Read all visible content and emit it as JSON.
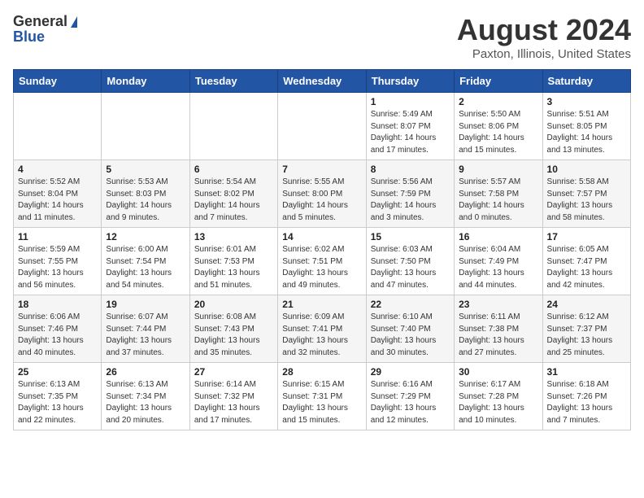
{
  "header": {
    "logo_general": "General",
    "logo_blue": "Blue",
    "title": "August 2024",
    "subtitle": "Paxton, Illinois, United States"
  },
  "days_of_week": [
    "Sunday",
    "Monday",
    "Tuesday",
    "Wednesday",
    "Thursday",
    "Friday",
    "Saturday"
  ],
  "weeks": [
    [
      {
        "day": "",
        "sunrise": "",
        "sunset": "",
        "daylight": ""
      },
      {
        "day": "",
        "sunrise": "",
        "sunset": "",
        "daylight": ""
      },
      {
        "day": "",
        "sunrise": "",
        "sunset": "",
        "daylight": ""
      },
      {
        "day": "",
        "sunrise": "",
        "sunset": "",
        "daylight": ""
      },
      {
        "day": "1",
        "sunrise": "Sunrise: 5:49 AM",
        "sunset": "Sunset: 8:07 PM",
        "daylight": "Daylight: 14 hours and 17 minutes."
      },
      {
        "day": "2",
        "sunrise": "Sunrise: 5:50 AM",
        "sunset": "Sunset: 8:06 PM",
        "daylight": "Daylight: 14 hours and 15 minutes."
      },
      {
        "day": "3",
        "sunrise": "Sunrise: 5:51 AM",
        "sunset": "Sunset: 8:05 PM",
        "daylight": "Daylight: 14 hours and 13 minutes."
      }
    ],
    [
      {
        "day": "4",
        "sunrise": "Sunrise: 5:52 AM",
        "sunset": "Sunset: 8:04 PM",
        "daylight": "Daylight: 14 hours and 11 minutes."
      },
      {
        "day": "5",
        "sunrise": "Sunrise: 5:53 AM",
        "sunset": "Sunset: 8:03 PM",
        "daylight": "Daylight: 14 hours and 9 minutes."
      },
      {
        "day": "6",
        "sunrise": "Sunrise: 5:54 AM",
        "sunset": "Sunset: 8:02 PM",
        "daylight": "Daylight: 14 hours and 7 minutes."
      },
      {
        "day": "7",
        "sunrise": "Sunrise: 5:55 AM",
        "sunset": "Sunset: 8:00 PM",
        "daylight": "Daylight: 14 hours and 5 minutes."
      },
      {
        "day": "8",
        "sunrise": "Sunrise: 5:56 AM",
        "sunset": "Sunset: 7:59 PM",
        "daylight": "Daylight: 14 hours and 3 minutes."
      },
      {
        "day": "9",
        "sunrise": "Sunrise: 5:57 AM",
        "sunset": "Sunset: 7:58 PM",
        "daylight": "Daylight: 14 hours and 0 minutes."
      },
      {
        "day": "10",
        "sunrise": "Sunrise: 5:58 AM",
        "sunset": "Sunset: 7:57 PM",
        "daylight": "Daylight: 13 hours and 58 minutes."
      }
    ],
    [
      {
        "day": "11",
        "sunrise": "Sunrise: 5:59 AM",
        "sunset": "Sunset: 7:55 PM",
        "daylight": "Daylight: 13 hours and 56 minutes."
      },
      {
        "day": "12",
        "sunrise": "Sunrise: 6:00 AM",
        "sunset": "Sunset: 7:54 PM",
        "daylight": "Daylight: 13 hours and 54 minutes."
      },
      {
        "day": "13",
        "sunrise": "Sunrise: 6:01 AM",
        "sunset": "Sunset: 7:53 PM",
        "daylight": "Daylight: 13 hours and 51 minutes."
      },
      {
        "day": "14",
        "sunrise": "Sunrise: 6:02 AM",
        "sunset": "Sunset: 7:51 PM",
        "daylight": "Daylight: 13 hours and 49 minutes."
      },
      {
        "day": "15",
        "sunrise": "Sunrise: 6:03 AM",
        "sunset": "Sunset: 7:50 PM",
        "daylight": "Daylight: 13 hours and 47 minutes."
      },
      {
        "day": "16",
        "sunrise": "Sunrise: 6:04 AM",
        "sunset": "Sunset: 7:49 PM",
        "daylight": "Daylight: 13 hours and 44 minutes."
      },
      {
        "day": "17",
        "sunrise": "Sunrise: 6:05 AM",
        "sunset": "Sunset: 7:47 PM",
        "daylight": "Daylight: 13 hours and 42 minutes."
      }
    ],
    [
      {
        "day": "18",
        "sunrise": "Sunrise: 6:06 AM",
        "sunset": "Sunset: 7:46 PM",
        "daylight": "Daylight: 13 hours and 40 minutes."
      },
      {
        "day": "19",
        "sunrise": "Sunrise: 6:07 AM",
        "sunset": "Sunset: 7:44 PM",
        "daylight": "Daylight: 13 hours and 37 minutes."
      },
      {
        "day": "20",
        "sunrise": "Sunrise: 6:08 AM",
        "sunset": "Sunset: 7:43 PM",
        "daylight": "Daylight: 13 hours and 35 minutes."
      },
      {
        "day": "21",
        "sunrise": "Sunrise: 6:09 AM",
        "sunset": "Sunset: 7:41 PM",
        "daylight": "Daylight: 13 hours and 32 minutes."
      },
      {
        "day": "22",
        "sunrise": "Sunrise: 6:10 AM",
        "sunset": "Sunset: 7:40 PM",
        "daylight": "Daylight: 13 hours and 30 minutes."
      },
      {
        "day": "23",
        "sunrise": "Sunrise: 6:11 AM",
        "sunset": "Sunset: 7:38 PM",
        "daylight": "Daylight: 13 hours and 27 minutes."
      },
      {
        "day": "24",
        "sunrise": "Sunrise: 6:12 AM",
        "sunset": "Sunset: 7:37 PM",
        "daylight": "Daylight: 13 hours and 25 minutes."
      }
    ],
    [
      {
        "day": "25",
        "sunrise": "Sunrise: 6:13 AM",
        "sunset": "Sunset: 7:35 PM",
        "daylight": "Daylight: 13 hours and 22 minutes."
      },
      {
        "day": "26",
        "sunrise": "Sunrise: 6:13 AM",
        "sunset": "Sunset: 7:34 PM",
        "daylight": "Daylight: 13 hours and 20 minutes."
      },
      {
        "day": "27",
        "sunrise": "Sunrise: 6:14 AM",
        "sunset": "Sunset: 7:32 PM",
        "daylight": "Daylight: 13 hours and 17 minutes."
      },
      {
        "day": "28",
        "sunrise": "Sunrise: 6:15 AM",
        "sunset": "Sunset: 7:31 PM",
        "daylight": "Daylight: 13 hours and 15 minutes."
      },
      {
        "day": "29",
        "sunrise": "Sunrise: 6:16 AM",
        "sunset": "Sunset: 7:29 PM",
        "daylight": "Daylight: 13 hours and 12 minutes."
      },
      {
        "day": "30",
        "sunrise": "Sunrise: 6:17 AM",
        "sunset": "Sunset: 7:28 PM",
        "daylight": "Daylight: 13 hours and 10 minutes."
      },
      {
        "day": "31",
        "sunrise": "Sunrise: 6:18 AM",
        "sunset": "Sunset: 7:26 PM",
        "daylight": "Daylight: 13 hours and 7 minutes."
      }
    ]
  ]
}
